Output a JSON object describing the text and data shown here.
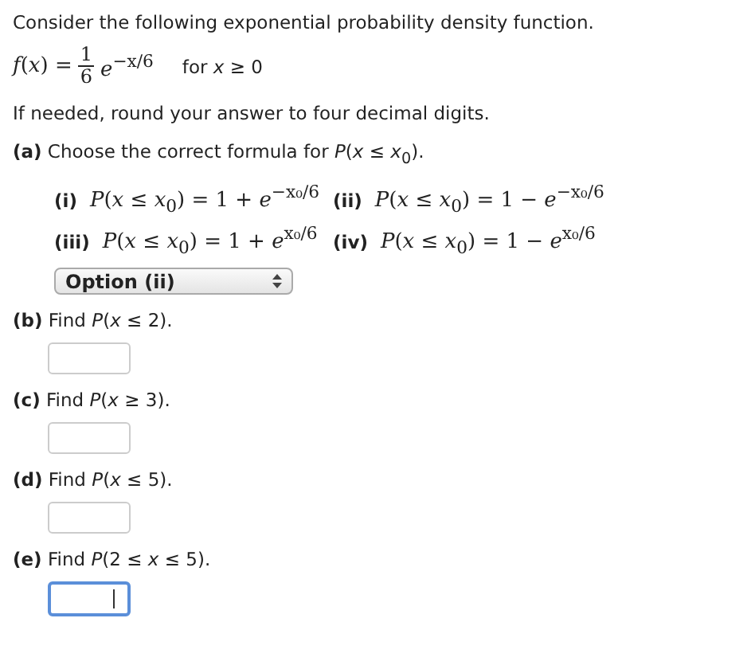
{
  "intro": "Consider the following exponential probability density function.",
  "formula": {
    "lhs": "*f*(*x*) =",
    "numerator": "1",
    "denominator": "6",
    "rhs": "*e*$^{−x/6}$",
    "condition": "for *x* ≥ 0"
  },
  "instruction": "If needed, round your answer to four decimal digits.",
  "part_a": {
    "question": "**(a)** Choose the correct formula for *P*(*x* ≤ *x*$_{0}$).",
    "options": [
      {
        "label": "(i)",
        "formula": "*P*(*x* ≤ *x*$_{0}$) = 1 + *e*$^{−x₀/6}$"
      },
      {
        "label": "(ii)",
        "formula": "*P*(*x* ≤ *x*$_{0}$) = 1 − *e*$^{−x₀/6}$"
      },
      {
        "label": "(iii)",
        "formula": "*P*(*x* ≤ *x*$_{0}$) = 1 + *e*$^{x₀/6}$"
      },
      {
        "label": "(iv)",
        "formula": "*P*(*x* ≤ *x*$_{0}$) = 1 − *e*$^{x₀/6}$"
      }
    ],
    "select": {
      "value": "Option (ii)"
    }
  },
  "parts": [
    {
      "question": "**(b)** Find *P*(*x* ≤ 2).",
      "focused": false
    },
    {
      "question": "**(c)** Find *P*(*x* ≥ 3).",
      "focused": false
    },
    {
      "question": "**(d)** Find *P*(*x* ≤ 5).",
      "focused": false
    },
    {
      "question": "**(e)** Find *P*(2 ≤ *x* ≤ 5).",
      "focused": true
    }
  ]
}
